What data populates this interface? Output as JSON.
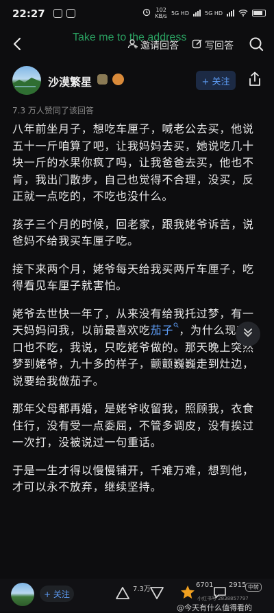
{
  "status": {
    "time": "22:27",
    "net_speed": "102",
    "net_unit": "KB/s",
    "signal_a": "5G HD",
    "signal_b": "5G HD"
  },
  "nav": {
    "overlay_text": "Take me to the address",
    "invite_label": "邀请回答",
    "write_label": "写回答"
  },
  "author": {
    "name": "沙漠繁星",
    "follow_label": "+ 关注",
    "likes_line": "7.3 万人赞同了该回答"
  },
  "answer": {
    "paragraphs": [
      "八年前坐月子，想吃车厘子，喊老公去买，他说五十一斤咱算了吧，让我妈妈去买，她说吃几十块一斤的水果你疯了吗，让我爸爸去买，他也不肯，我出门散步，自己也觉得不合理，没买，反正就一点吃的，不吃也没什么。",
      "孩子三个月的时候，回老家，跟我姥爷诉苦，说爸妈不给我买车厘子吃。",
      "接下来两个月，姥爷每天给我买两斤车厘子，吃得看见车厘子就害怕。",
      "",
      "那年父母都再婚，是姥爷收留我，照顾我，衣食住行，没有受一点委屈，不管多调皮，没有挨过一次打，没被说过一句重话。",
      "于是一生才得以慢慢铺开，千难万难，想到他，才可以永不放弃，继续坚持。"
    ],
    "p4_before_link": "姥爷去世快一年了，从来没有给我托过梦，有一天妈妈问我，以前最喜欢吃",
    "p4_link": "茄子",
    "p4_after_link": "，为什么现在一口也不吃，我说，只吃姥爷做的。那天晚上突然梦到姥爷，九十多的样子，颤颤巍巍走到灶边，说要给我做茄子。"
  },
  "bottom": {
    "follow_label": "+ 关注",
    "vote_count": "7.3万",
    "star_count": "6701",
    "comment_count": "2915",
    "more_badge": "中转",
    "watermark_small": "小红书号 2838857797",
    "watermark": "@今天有什么值得看的"
  },
  "colors": {
    "background": "#0d0d0f",
    "link": "#5d9cf5",
    "star": "#f0a020",
    "overlay_green": "#2fb86e"
  }
}
